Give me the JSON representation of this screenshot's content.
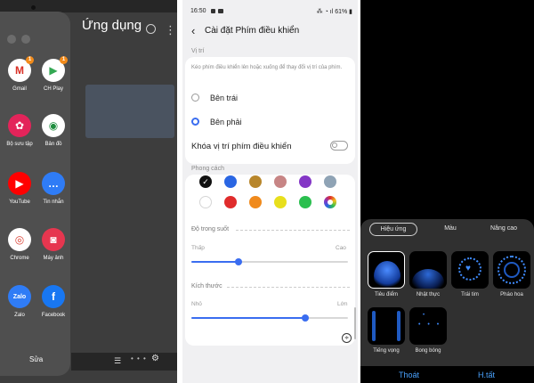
{
  "left_panel": {
    "title": "Ứng dụng",
    "edit_label": "Sửa",
    "pagination": "• • •",
    "apps": [
      {
        "label": "Gmail",
        "icon": "gmail-icon",
        "badge": "1",
        "color": "#ffffff",
        "glyph": "M",
        "glyph_color": "#d93025"
      },
      {
        "label": "CH Play",
        "icon": "play-store-icon",
        "badge": "1",
        "color": "#ffffff",
        "glyph": "▶",
        "glyph_color": "#34a853"
      },
      {
        "label": "Bộ sưu tập",
        "icon": "gallery-icon",
        "badge": "",
        "color": "#e3245a",
        "glyph": "✿",
        "glyph_color": "#ffffff"
      },
      {
        "label": "Bản đồ",
        "icon": "maps-icon",
        "badge": "",
        "color": "#ffffff",
        "glyph": "◉",
        "glyph_color": "#1e8e3e"
      },
      {
        "label": "YouTube",
        "icon": "youtube-icon",
        "badge": "",
        "color": "#ff0000",
        "glyph": "▶",
        "glyph_color": "#ffffff"
      },
      {
        "label": "Tin nhắn",
        "icon": "messages-icon",
        "badge": "",
        "color": "#2f7cf6",
        "glyph": "…",
        "glyph_color": "#ffffff"
      },
      {
        "label": "Chrome",
        "icon": "chrome-icon",
        "badge": "",
        "color": "#ffffff",
        "glyph": "◎",
        "glyph_color": "#db4437"
      },
      {
        "label": "Máy ảnh",
        "icon": "camera-icon",
        "badge": "",
        "color": "#e6364f",
        "glyph": "◙",
        "glyph_color": "#ffffff"
      },
      {
        "label": "Zalo",
        "icon": "zalo-icon",
        "badge": "",
        "color": "#2f7cf6",
        "glyph": "Zalo",
        "glyph_color": "#ffffff"
      },
      {
        "label": "Facebook",
        "icon": "facebook-icon",
        "badge": "",
        "color": "#1877f2",
        "glyph": "f",
        "glyph_color": "#ffffff"
      }
    ]
  },
  "settings_panel": {
    "status_time": "16:50",
    "status_right": "⁂ ◔ ıl 61% ▮",
    "title": "Cài đặt Phím điều khiển",
    "position_section": "Vị trí",
    "position_desc": "Kéo phím điều khiển lên hoặc xuống để thay đổi vị trí của phím.",
    "option_left": "Bên trái",
    "option_right": "Bên phải",
    "selected_option": "right",
    "lock_label": "Khóa vị trí phím điều khiển",
    "lock_on": false,
    "style_section": "Phong cách",
    "colors": [
      "#111111",
      "#2a66e3",
      "#b8862b",
      "#c78585",
      "#8437c6",
      "#8fa3b5",
      "#ffffff",
      "#e02c2c",
      "#f08a1c",
      "#e8df1c",
      "#2bbf4f",
      "rainbow"
    ],
    "selected_color_index": 0,
    "transparency_label": "Độ trong suốt",
    "transparency_low": "Thấp",
    "transparency_high": "Cao",
    "transparency_value": 0.3,
    "size_label": "Kích thước",
    "size_low": "Nhỏ",
    "size_high": "Lớn",
    "size_value": 0.73
  },
  "effects_panel": {
    "tabs": [
      "Hiệu ứng",
      "Màu",
      "Nâng cao"
    ],
    "active_tab": 0,
    "effects": [
      {
        "label": "Tiêu điểm",
        "icon": "spotlight-effect-icon",
        "selected": true
      },
      {
        "label": "Nhật thực",
        "icon": "eclipse-effect-icon",
        "selected": false
      },
      {
        "label": "Trái tim",
        "icon": "heart-effect-icon",
        "selected": false
      },
      {
        "label": "Pháo hoa",
        "icon": "fireworks-effect-icon",
        "selected": false
      },
      {
        "label": "Tiếng vọng",
        "icon": "echo-effect-icon",
        "selected": false
      },
      {
        "label": "Bong bóng",
        "icon": "bubbles-effect-icon",
        "selected": false
      }
    ],
    "exit_label": "Thoát",
    "done_label": "H.tất"
  }
}
